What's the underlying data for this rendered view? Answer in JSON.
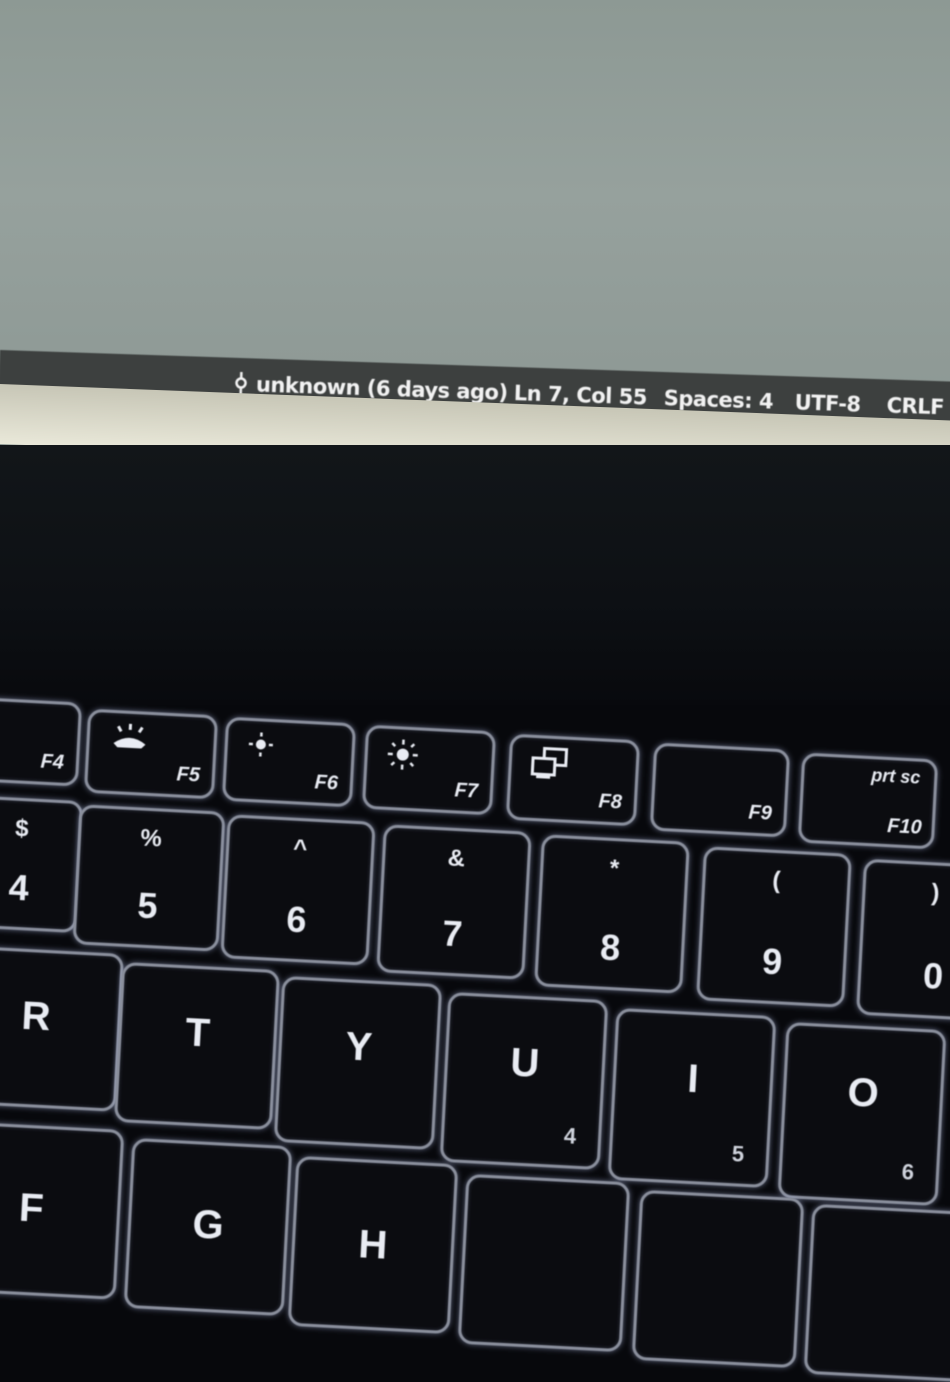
{
  "status_bar": {
    "branch_icon": "git-commit-icon",
    "branch": "unknown (6 days ago)",
    "cursor": "Ln 7, Col 55",
    "indent": "Spaces: 4",
    "encoding": "UTF-8",
    "eol": "CRLF"
  },
  "keyboard": {
    "function_keys": {
      "f4": "F4",
      "f5": "F5",
      "f6": "F6",
      "f7": "F7",
      "f8": "F8",
      "f9": "F9",
      "f10": "F10",
      "f10_alt": "prt sc",
      "f5_icon": "keyboard-backlight-icon",
      "f6_icon": "brightness-down-icon",
      "f7_icon": "brightness-up-icon",
      "f8_icon": "display-switch-icon"
    },
    "number_keys": {
      "four": {
        "sym": "$",
        "main": "4"
      },
      "five": {
        "sym": "%",
        "main": "5"
      },
      "six": {
        "sym": "^",
        "main": "6"
      },
      "seven": {
        "sym": "&",
        "main": "7"
      },
      "eight": {
        "sym": "*",
        "main": "8"
      },
      "nine": {
        "sym": "(",
        "main": "9"
      },
      "zero": {
        "sym": ")",
        "main": "0"
      }
    },
    "top_row": {
      "r": {
        "main": "R"
      },
      "t": {
        "main": "T"
      },
      "y": {
        "main": "Y"
      },
      "u": {
        "main": "U",
        "sub": "4"
      },
      "i": {
        "main": "I",
        "sub": "5"
      },
      "o": {
        "main": "O",
        "sub": "6"
      }
    },
    "home_row": {
      "f": {
        "main": "F"
      },
      "g": {
        "main": "G"
      },
      "h": {
        "main": "H"
      }
    }
  },
  "colors": {
    "screen": "#96a19d",
    "status_bar": "#3d403f",
    "bezel": "#e9e8d9",
    "key_backlight": "#8a8f9c"
  }
}
